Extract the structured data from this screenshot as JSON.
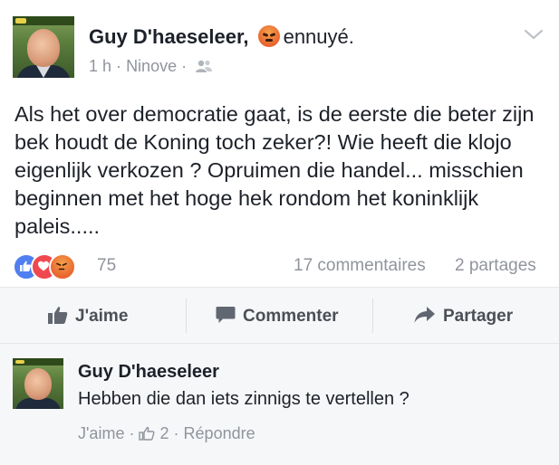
{
  "post": {
    "author": "Guy D'haeseleer",
    "name_comma": ",",
    "feeling": "ennuyé.",
    "time": "1 h",
    "dot": "·",
    "location": "Ninove",
    "dot2": "·",
    "body": "Als het over democratie gaat, is de eerste die beter zijn bek houdt de Koning toch zeker?! Wie heeft die klojo eigenlijk verkozen ? Opruimen die handel... misschien beginnen met het hoge hek rondom het koninklijk paleis.....",
    "reaction_count": "75",
    "comments_count": "17 commentaires",
    "shares_count": "2 partages"
  },
  "actions": {
    "like": "J'aime",
    "comment": "Commenter",
    "share": "Partager"
  },
  "comment": {
    "author": "Guy D'haeseleer",
    "text": "Hebben die dan iets zinnigs te vertellen ?",
    "like": "J'aime",
    "sep1": "·",
    "likes": "2",
    "sep2": "·",
    "reply": "Répondre"
  },
  "icons": {
    "reactions": [
      "like-reaction-icon",
      "love-reaction-icon",
      "angry-reaction-icon"
    ],
    "feeling": "angry-emoji-icon",
    "audience": "friends-icon",
    "menu": "chevron-down-icon"
  },
  "colors": {
    "text": "#1d2129",
    "secondary": "#90949c",
    "like_blue": "#4f7ff0",
    "love_red": "#f0484f",
    "angry_orange": "#e8652e"
  }
}
